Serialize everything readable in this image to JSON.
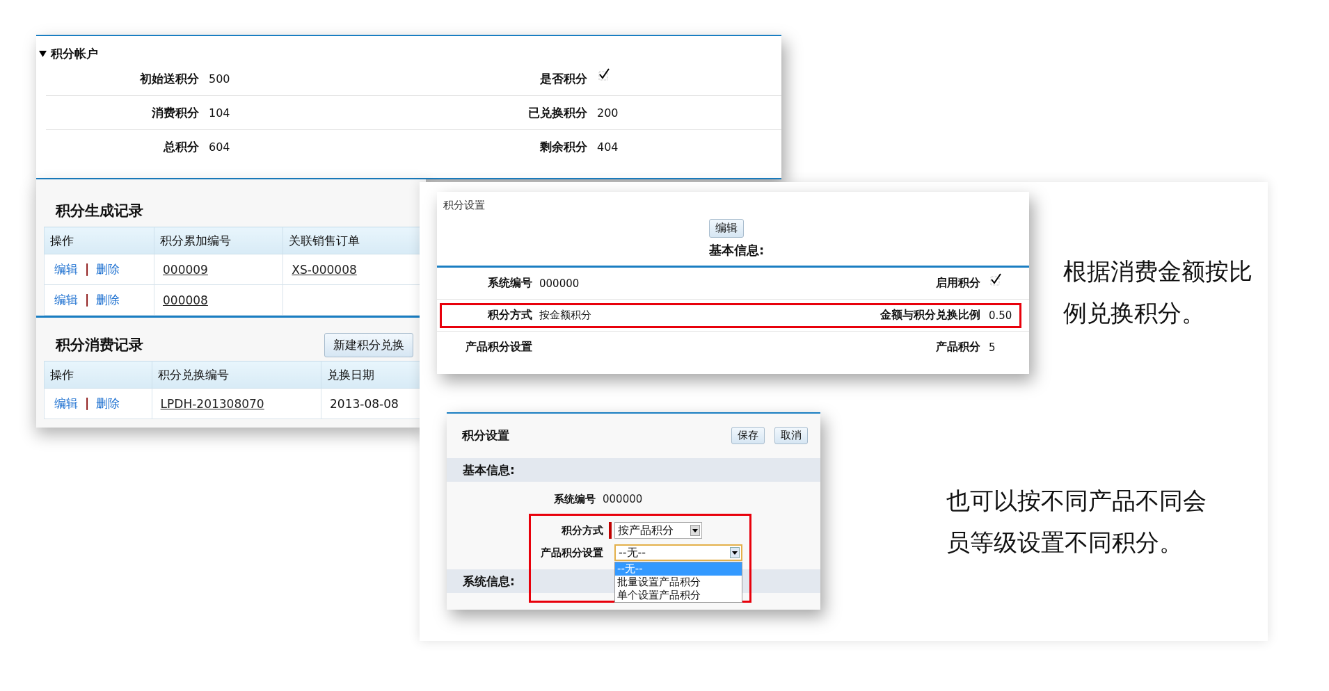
{
  "account_panel": {
    "title": "积分帐户",
    "expanded": true,
    "rows": [
      {
        "fields": [
          {
            "label": "初始送积分",
            "kind": "text",
            "value": "500"
          },
          {
            "label": "是否积分",
            "kind": "checkbox",
            "checked": true
          }
        ]
      },
      {
        "fields": [
          {
            "label": "消费积分",
            "kind": "text",
            "value": "104"
          },
          {
            "label": "已兑换积分",
            "kind": "text",
            "value": "200"
          }
        ]
      },
      {
        "fields": [
          {
            "label": "总积分",
            "kind": "text",
            "value": "604"
          },
          {
            "label": "剩余积分",
            "kind": "text",
            "value": "404"
          }
        ]
      }
    ]
  },
  "generated_records": {
    "title": "积分生成记录",
    "columns": [
      "操作",
      "积分累加编号",
      "关联销售订单"
    ],
    "rows": [
      {
        "cells": [
          {
            "kind": "actions",
            "actions": [
              "编辑",
              "删除"
            ],
            "separator": "|"
          },
          {
            "kind": "link",
            "text": "000009"
          },
          {
            "kind": "link",
            "text": "XS-000008"
          }
        ]
      },
      {
        "cells": [
          {
            "kind": "actions",
            "actions": [
              "编辑",
              "删除"
            ],
            "separator": "|"
          },
          {
            "kind": "link",
            "text": "000008"
          },
          {
            "kind": "empty"
          }
        ]
      }
    ]
  },
  "consumption_records": {
    "title": "积分消费记录",
    "button": "新建积分兑换",
    "columns": [
      "操作",
      "积分兑换编号",
      "兑换日期"
    ],
    "rows": [
      {
        "cells": [
          {
            "kind": "actions",
            "actions": [
              "编辑",
              "删除"
            ],
            "separator": "|"
          },
          {
            "kind": "link",
            "text": "LPDH-201308070"
          },
          {
            "kind": "text",
            "text": "2013-08-08"
          }
        ]
      }
    ]
  },
  "settings_view": {
    "title": "积分设置",
    "edit_button": "编辑",
    "section": "基本信息:",
    "rows": [
      {
        "highlighted": false,
        "fields": [
          {
            "label": "系统编号",
            "kind": "text",
            "value": "000000"
          },
          {
            "label": "启用积分",
            "kind": "checkbox",
            "checked": true
          }
        ]
      },
      {
        "highlighted": true,
        "fields": [
          {
            "label": "积分方式",
            "kind": "text",
            "value": "按金额积分"
          },
          {
            "label": "金额与积分兑换比例",
            "kind": "text",
            "value": "0.50"
          }
        ]
      },
      {
        "highlighted": false,
        "fields": [
          {
            "label": "产品积分设置",
            "kind": "text"
          },
          {
            "label": "产品积分",
            "kind": "text",
            "value": "5"
          }
        ]
      }
    ]
  },
  "settings_edit": {
    "title": "积分设置",
    "buttons": [
      "保存",
      "取消"
    ],
    "basic_section": "基本信息:",
    "system_number": {
      "label": "系统编号",
      "value": "000000"
    },
    "highlighted": true,
    "mode_field": {
      "label": "积分方式",
      "required": true,
      "value": "按产品积分"
    },
    "product_field": {
      "label": "产品积分设置",
      "value": "--无--",
      "open": true,
      "options": [
        {
          "label": "--无--",
          "selected": true
        },
        {
          "label": "批量设置产品积分",
          "selected": false
        },
        {
          "label": "单个设置产品积分",
          "selected": false
        }
      ]
    },
    "system_section": "系统信息:"
  },
  "notes": [
    "根据消费金额按比例兑换积分。",
    "也可以按不同产品不同会员等级设置不同积分。"
  ]
}
